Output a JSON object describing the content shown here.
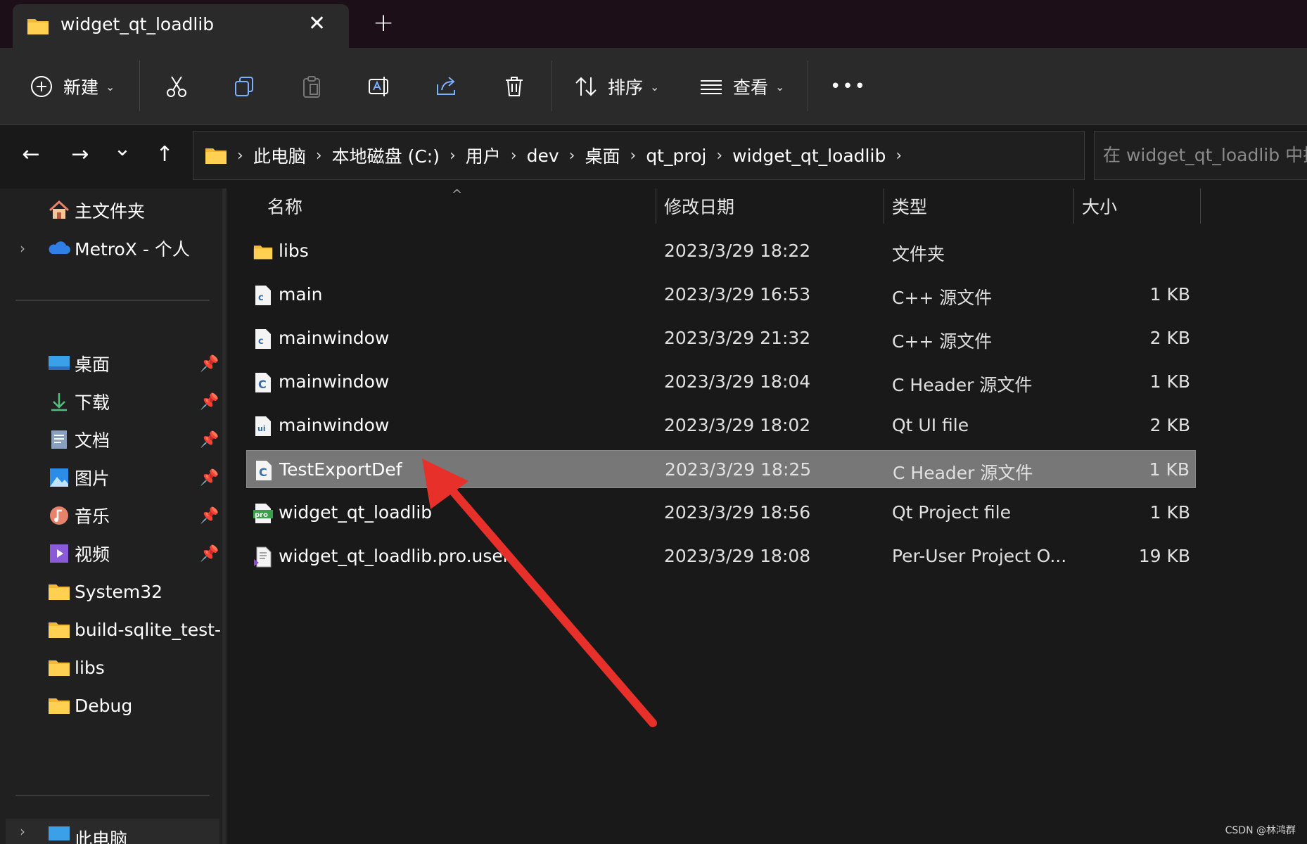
{
  "tab": {
    "title": "widget_qt_loadlib",
    "close": "✕",
    "new": "+"
  },
  "toolbar": {
    "new_label": "新建",
    "sort_label": "排序",
    "view_label": "查看",
    "more": "•••"
  },
  "nav": {
    "back": "←",
    "forward": "→",
    "recent": "⌄",
    "up": "↑",
    "breadcrumb": [
      "此电脑",
      "本地磁盘 (C:)",
      "用户",
      "dev",
      "桌面",
      "qt_proj",
      "widget_qt_loadlib"
    ],
    "search_placeholder": "在 widget_qt_loadlib 中搜索"
  },
  "sidebar": {
    "top": [
      {
        "label": "主文件夹",
        "icon": "home-icon"
      },
      {
        "label": "MetroX - 个人",
        "icon": "cloud-icon"
      }
    ],
    "pinned": [
      {
        "label": "桌面",
        "icon": "desktop-icon"
      },
      {
        "label": "下载",
        "icon": "download-icon"
      },
      {
        "label": "文档",
        "icon": "document-icon"
      },
      {
        "label": "图片",
        "icon": "pictures-icon"
      },
      {
        "label": "音乐",
        "icon": "music-icon"
      },
      {
        "label": "视频",
        "icon": "video-icon"
      }
    ],
    "folders": [
      {
        "label": "System32"
      },
      {
        "label": "build-sqlite_test-D"
      },
      {
        "label": "libs"
      },
      {
        "label": "Debug"
      }
    ],
    "bottom": {
      "label": "此电脑"
    }
  },
  "columns": {
    "name": "名称",
    "modified": "修改日期",
    "type": "类型",
    "size": "大小"
  },
  "files": [
    {
      "name": "libs",
      "date": "2023/3/29 18:22",
      "type": "文件夹",
      "size": "",
      "icon": "folder-icon"
    },
    {
      "name": "main",
      "date": "2023/3/29 16:53",
      "type": "C++ 源文件",
      "size": "1 KB",
      "icon": "cpp-file-icon"
    },
    {
      "name": "mainwindow",
      "date": "2023/3/29 21:32",
      "type": "C++ 源文件",
      "size": "2 KB",
      "icon": "cpp-file-icon"
    },
    {
      "name": "mainwindow",
      "date": "2023/3/29 18:04",
      "type": "C Header 源文件",
      "size": "1 KB",
      "icon": "header-file-icon"
    },
    {
      "name": "mainwindow",
      "date": "2023/3/29 18:02",
      "type": "Qt UI file",
      "size": "2 KB",
      "icon": "ui-file-icon"
    },
    {
      "name": "TestExportDef",
      "date": "2023/3/29 18:25",
      "type": "C Header 源文件",
      "size": "1 KB",
      "icon": "header-file-icon",
      "selected": true
    },
    {
      "name": "widget_qt_loadlib",
      "date": "2023/3/29 18:56",
      "type": "Qt Project file",
      "size": "1 KB",
      "icon": "pro-file-icon"
    },
    {
      "name": "widget_qt_loadlib.pro.user",
      "date": "2023/3/29 18:08",
      "type": "Per-User Project O...",
      "size": "19 KB",
      "icon": "user-file-icon"
    }
  ],
  "annotation": {
    "arrow_color": "#e8302a"
  },
  "watermark": "CSDN @林鸿群"
}
